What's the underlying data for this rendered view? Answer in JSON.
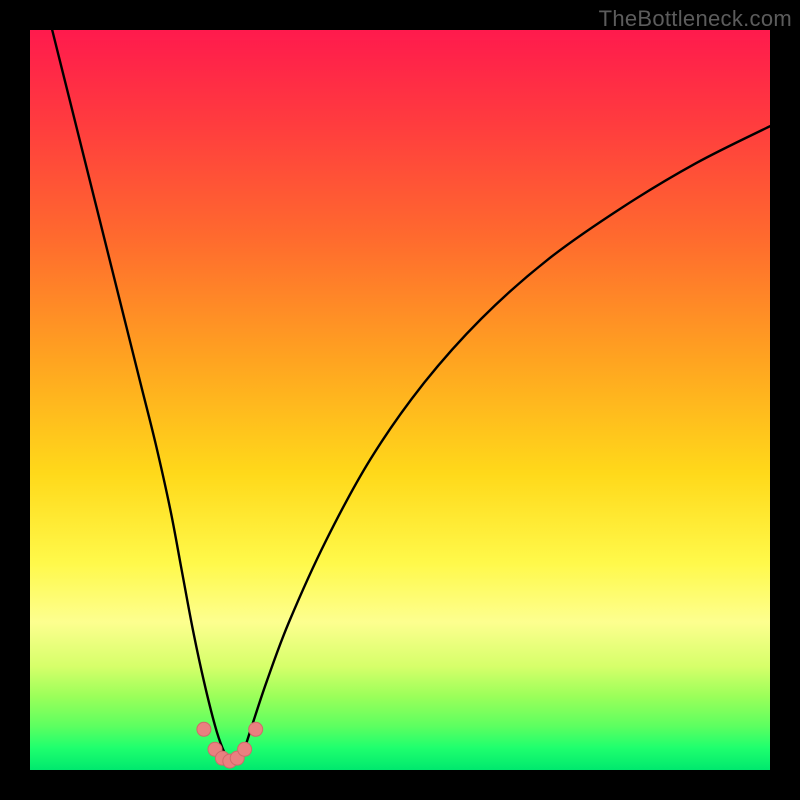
{
  "watermark": "TheBottleneck.com",
  "colors": {
    "curve": "#000000",
    "marker_fill": "#e98080",
    "marker_stroke": "#cf6a6a"
  },
  "chart_data": {
    "type": "line",
    "title": "",
    "xlabel": "",
    "ylabel": "",
    "xlim": [
      0,
      100
    ],
    "ylim": [
      0,
      100
    ],
    "grid": false,
    "legend": false,
    "series": [
      {
        "name": "curve",
        "x": [
          3,
          5,
          7,
          9,
          11,
          13,
          15,
          17,
          19,
          20.5,
          22,
          23.5,
          25,
          26,
          27,
          28,
          29,
          30,
          32,
          35,
          40,
          46,
          53,
          61,
          70,
          80,
          90,
          100
        ],
        "y": [
          100,
          92,
          84,
          76,
          68,
          60,
          52,
          44,
          35,
          27,
          19,
          12,
          6,
          3,
          1.2,
          1.2,
          3,
          6,
          12,
          20,
          31,
          42,
          52,
          61,
          69,
          76,
          82,
          87
        ]
      }
    ],
    "markers": {
      "name": "highlighted-points",
      "x": [
        23.5,
        25,
        26,
        27,
        28,
        29,
        30.5
      ],
      "y": [
        5.5,
        2.8,
        1.6,
        1.2,
        1.6,
        2.8,
        5.5
      ]
    }
  }
}
